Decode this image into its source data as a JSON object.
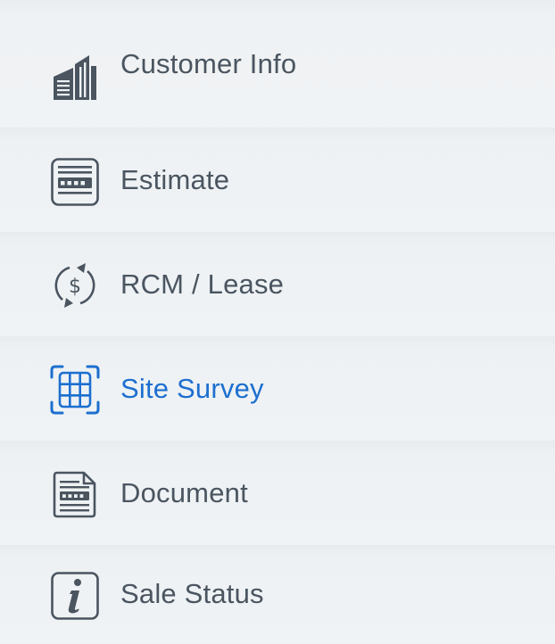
{
  "nav": {
    "items": [
      {
        "label": "Customer Info",
        "icon": "building-icon",
        "active": false
      },
      {
        "label": "Estimate",
        "icon": "calculator-icon",
        "active": false
      },
      {
        "label": "RCM / Lease",
        "icon": "dollar-cycle-icon",
        "active": false
      },
      {
        "label": "Site Survey",
        "icon": "grid-scan-icon",
        "active": true
      },
      {
        "label": "Document",
        "icon": "document-icon",
        "active": false
      },
      {
        "label": "Sale Status",
        "icon": "info-icon",
        "active": false
      }
    ]
  },
  "colors": {
    "text": "#4a5560",
    "active": "#1d6fd0",
    "icon": "#4a5560",
    "background": "#f0f3f5"
  }
}
